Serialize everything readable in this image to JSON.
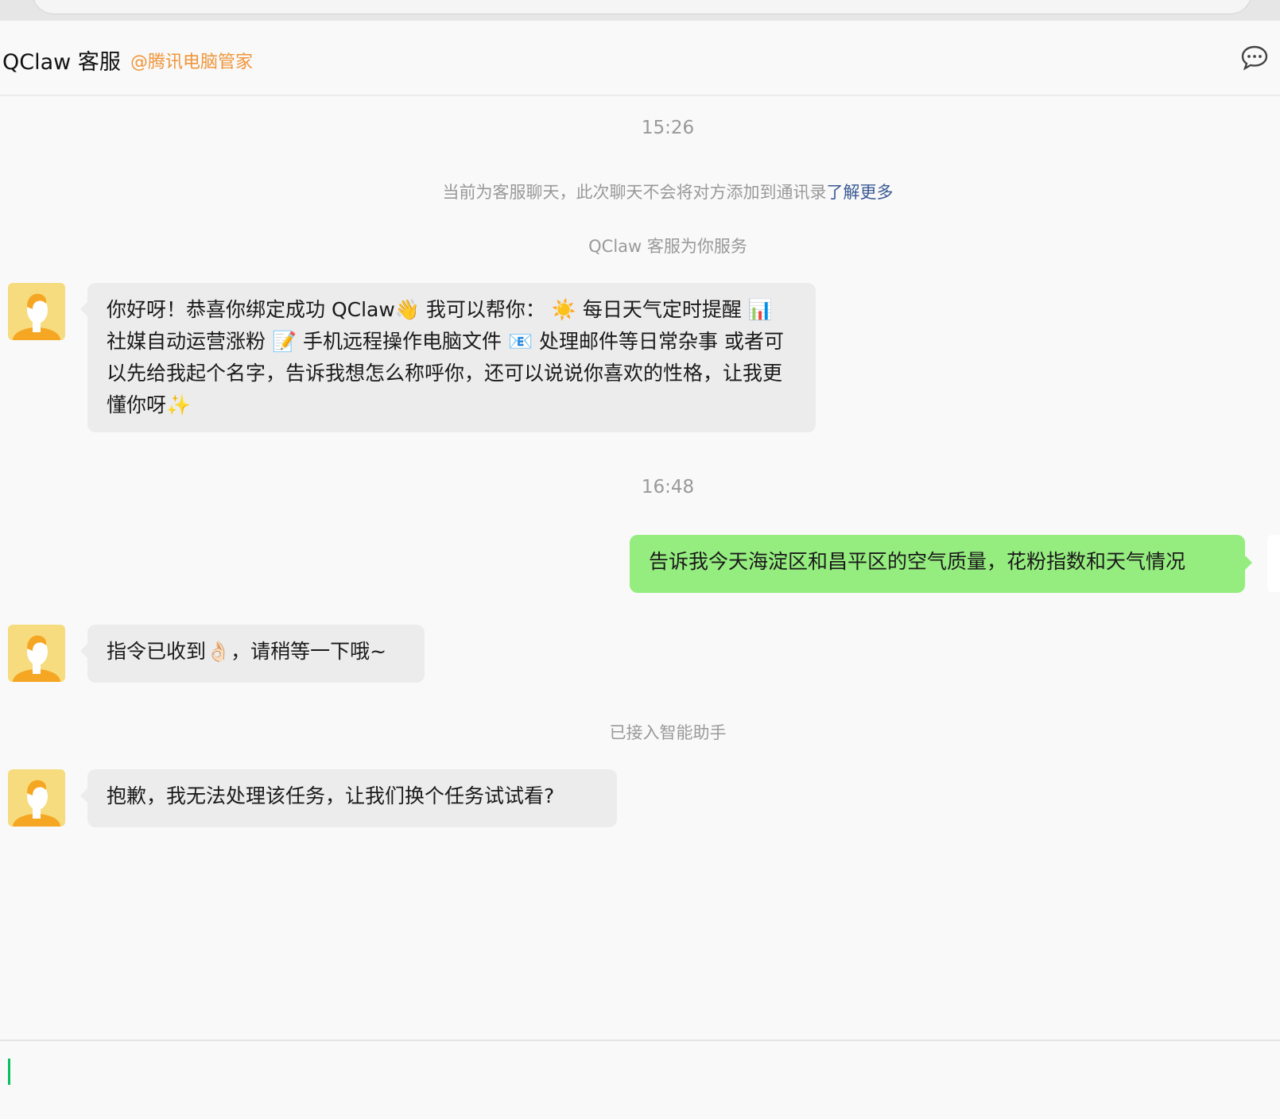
{
  "header": {
    "title": "QClaw 客服",
    "subtitle": "@腾讯电脑管家",
    "menu_icon": "chat-bubble-more-icon"
  },
  "messages": {
    "ts1": "15:26",
    "notice": "当前为客服聊天，此次聊天不会将对方添加到通讯录",
    "notice_link": "了解更多",
    "service": "QClaw 客服为你服务",
    "m1": "你好呀！恭喜你绑定成功 QClaw👋 我可以帮你： ☀️ 每日天气定时提醒 📊 社媒自动运营涨粉 📝 手机远程操作电脑文件 📧 处理邮件等日常杂事 或者可以先给我起个名字，告诉我想怎么称呼你，还可以说说你喜欢的性格，让我更懂你呀✨",
    "ts2": "16:48",
    "m2": "告诉我今天海淀区和昌平区的空气质量，花粉指数和天气情况",
    "m3": "指令已收到👌🏻，请稍等一下哦~",
    "system": "已接入智能助手",
    "m4": "抱歉，我无法处理该任务，让我们换个任务试试看?"
  },
  "colors": {
    "accent": "#f0953a",
    "user_bubble": "#95ec7f",
    "link": "#3a5a94"
  }
}
